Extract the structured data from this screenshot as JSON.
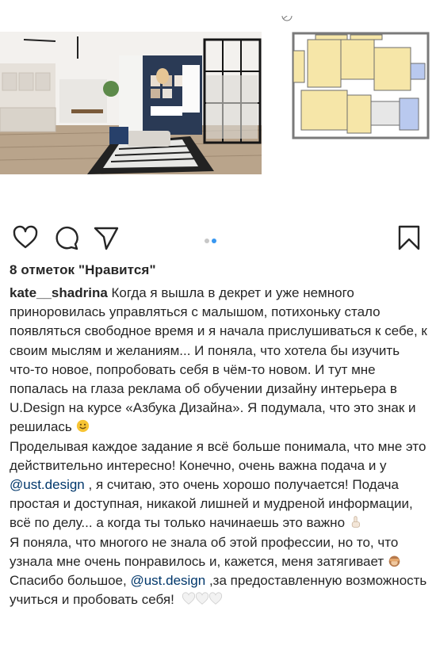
{
  "post": {
    "likes_text": "8 отметок \"Нравится\"",
    "carousel": {
      "slides": 2,
      "active": 2
    },
    "caption": {
      "username": "kate__shadrina",
      "p1": "Когда я вышла в декрет и уже немного приноровилась управляться с малышом, потихоньку стало появляться свободное время и я начала прислушиваться к себе, к своим мыслям и желаниям... И поняла, что хотела бы изучить что-то новое, попробовать себя в чём-то новом. И тут мне попалась на глаза реклама об обучении дизайну интерьера в U.Design на курсе «Азбука Дизайна». Я подумала, что это знак и решилась",
      "p2a": "Проделывая каждое задание я всё больше понимала, что мне это действительно интересно! Конечно, очень важна подача и у",
      "mention1": "@ust.design",
      "p2b": ", я считаю, это очень хорошо получается! Подача простая и доступная, никакой лишней и мудреной информации, всё по делу... а когда ты только начинаешь это важно",
      "p3": "Я поняла, что многого не знала об этой профессии, но то, что узнала мне очень понравилось и, кажется, меня затягивает",
      "p4a": "Спасибо большое,",
      "mention2": "@ust.design",
      "p4b": ",за предоставленную возможность учиться и пробовать себя!"
    }
  },
  "icons": {
    "like": "heart-icon",
    "comment": "comment-icon",
    "share": "paper-plane-icon",
    "save": "bookmark-icon",
    "emoji1": "smiling-face-icon",
    "emoji2": "pointing-up-icon",
    "emoji3": "see-no-evil-monkey-icon",
    "emoji4": "white-heart-icon"
  },
  "colors": {
    "accent": "#3897f0",
    "mention": "#00376b",
    "text": "#262626"
  }
}
